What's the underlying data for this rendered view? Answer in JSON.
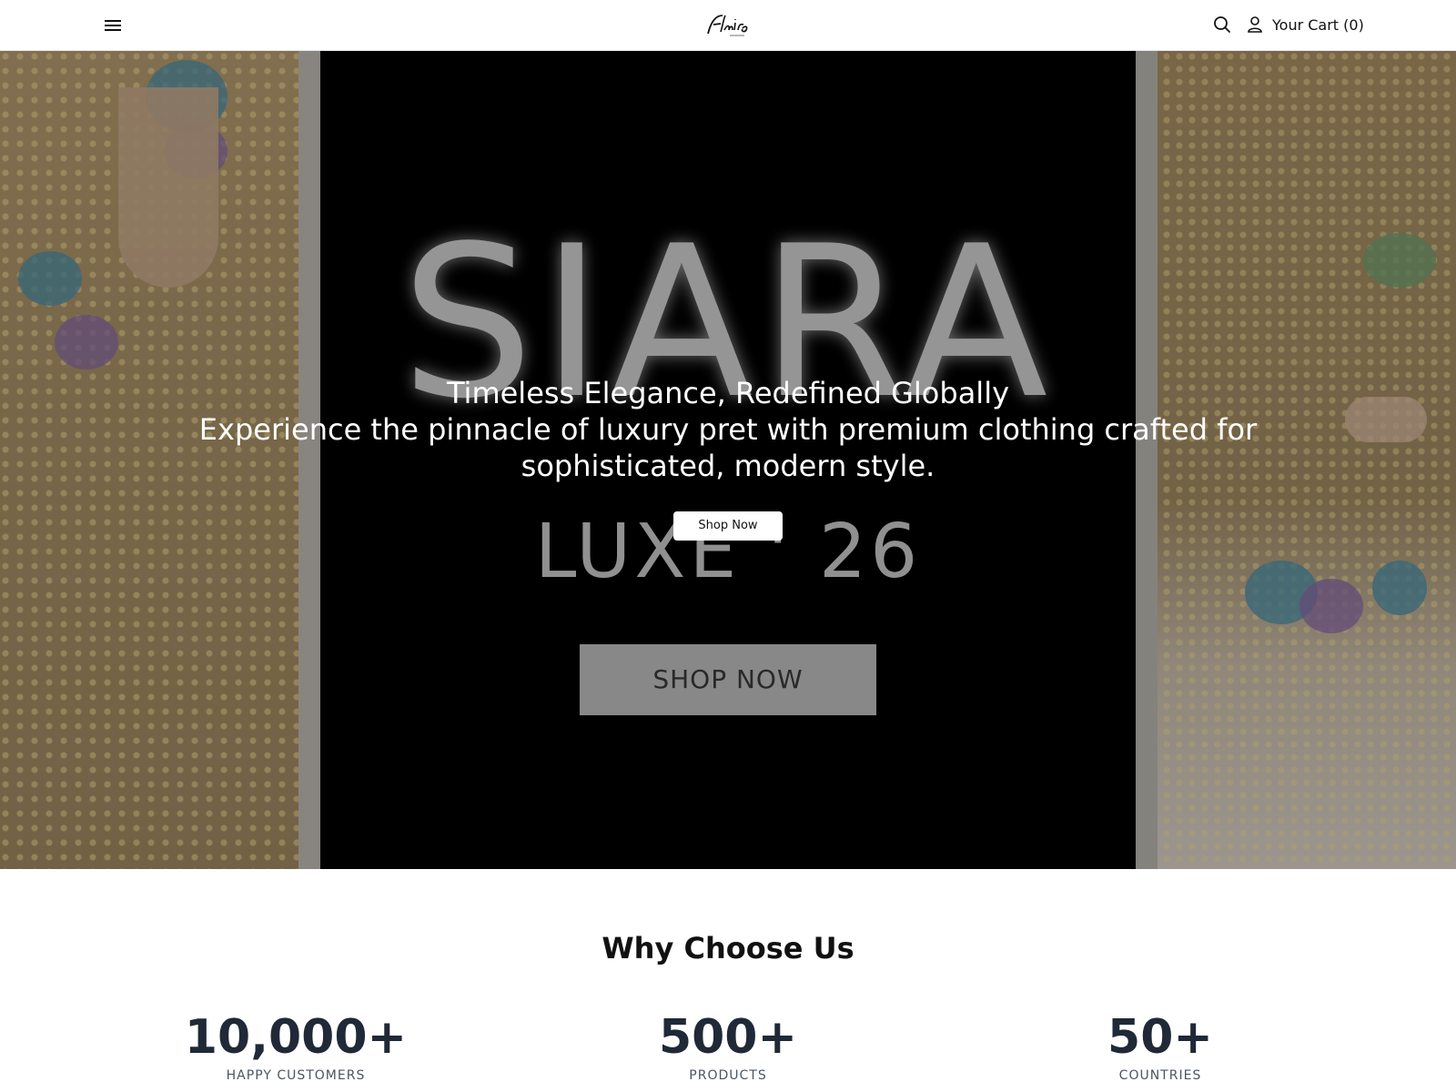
{
  "header": {
    "menu_icon": "hamburger-menu-icon",
    "logo_text": "Flairs",
    "search_icon": "search-icon",
    "account_icon": "user-icon",
    "cart_label": "Your Cart (0)"
  },
  "hero": {
    "background_brand": "SIARA",
    "background_collection": "LUXE ' 26",
    "background_cta": "SHOP NOW",
    "title": "Timeless Elegance, Redefined Globally",
    "subtitle": "Experience the pinnacle of luxury pret with premium clothing crafted for sophisticated, modern style.",
    "cta_label": "Shop Now"
  },
  "why": {
    "title": "Why Choose Us",
    "stats": [
      {
        "value": "10,000+",
        "label": "HAPPY CUSTOMERS"
      },
      {
        "value": "500+",
        "label": "PRODUCTS"
      },
      {
        "value": "50+",
        "label": "COUNTRIES"
      }
    ]
  },
  "colors": {
    "accent_text": "#1f2937",
    "hero_text": "#ffffff"
  }
}
